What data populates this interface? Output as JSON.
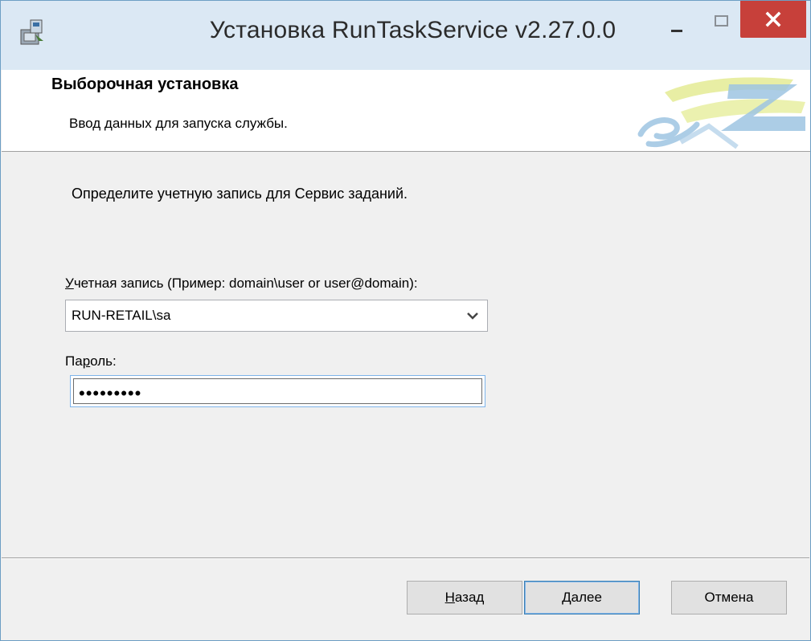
{
  "window": {
    "title": "Установка RunTaskService v2.27.0.0",
    "accent_close": "#c7403a",
    "titlebar_bg": "#dbe8f4"
  },
  "icons": {
    "app": "installer-icon",
    "minimize": "minimize-icon",
    "maximize": "maximize-icon",
    "close": "close-icon",
    "dropdown": "chevron-down-icon",
    "logo": "brand-logo"
  },
  "banner": {
    "title": "Выборочная установка",
    "subtitle": "Ввод данных для запуска службы."
  },
  "form": {
    "instruction": "Определите учетную запись для Сервис заданий.",
    "account_label_first": "У",
    "account_label_rest": "четная запись (Пример: domain\\user or user@domain):",
    "account_value": "RUN-RETAIL\\sa",
    "password_label_first": "Па",
    "password_label_u": "р",
    "password_label_rest": "оль:",
    "password_value": "•••••••••"
  },
  "buttons": {
    "back_u": "Н",
    "back_rest": "азад",
    "next_u": "Д",
    "next_rest": "алее",
    "cancel": "Отмена"
  }
}
